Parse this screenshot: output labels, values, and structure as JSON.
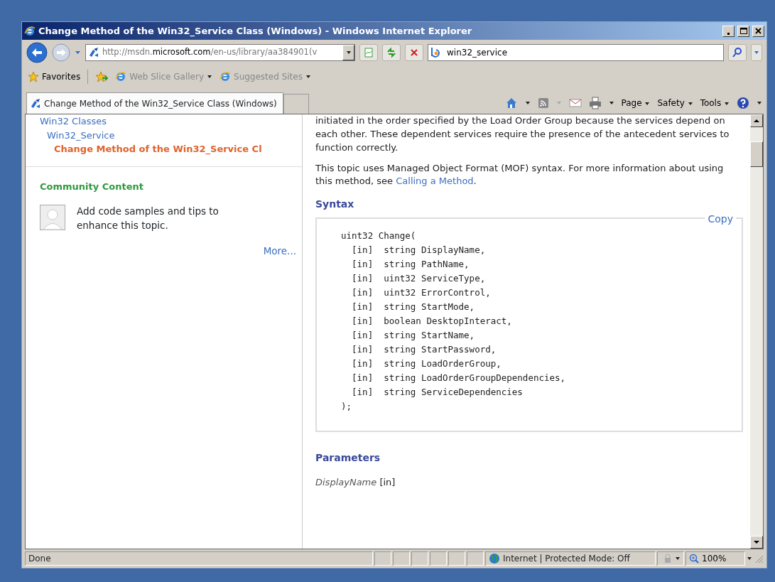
{
  "window": {
    "title": "Change Method of the Win32_Service Class (Windows) - Windows Internet Explorer"
  },
  "address_bar": {
    "url": "http://msdn.**microsoft.com**/en-us/library/aa384901(v"
  },
  "search": {
    "value": "win32_service"
  },
  "favorites_bar": {
    "label": "Favorites",
    "items": [
      {
        "label": "Web Slice Gallery"
      },
      {
        "label": "Suggested Sites"
      }
    ]
  },
  "tabs": [
    {
      "label": "Change Method of the Win32_Service Class (Windows)",
      "selected": true
    }
  ],
  "command_bar": [
    {
      "label": "Page"
    },
    {
      "label": "Safety"
    },
    {
      "label": "Tools"
    }
  ],
  "sidebar": {
    "tree": [
      {
        "label": "Win32 Classes",
        "selected": false,
        "children": [
          {
            "label": "Win32_Service",
            "selected": false,
            "children": [
              {
                "label": "Change Method of the Win32_Service Cl",
                "selected": true
              }
            ]
          }
        ]
      }
    ],
    "community": {
      "heading": "Community Content",
      "text": "Add code samples and tips to enhance this topic.",
      "more": "More..."
    }
  },
  "article": {
    "paragraphs": [
      {
        "text": "initiated in the order specified by the Load Order Group because the services depend on each other. These dependent services require the presence of the antecedent services to function correctly."
      },
      {
        "text": "This topic uses Managed Object Format (MOF) syntax. For more information about using this method, see ",
        "link": "Calling a Method",
        "after": "."
      }
    ],
    "syntax_heading": "Syntax",
    "copy": "Copy",
    "code_lines": [
      "uint32 Change(",
      "  [in]  string DisplayName,",
      "  [in]  string PathName,",
      "  [in]  uint32 ServiceType,",
      "  [in]  uint32 ErrorControl,",
      "  [in]  string StartMode,",
      "  [in]  boolean DesktopInteract,",
      "  [in]  string StartName,",
      "  [in]  string StartPassword,",
      "  [in]  string LoadOrderGroup,",
      "  [in]  string LoadOrderGroupDependencies,",
      "  [in]  string ServiceDependencies",
      ");"
    ],
    "parameters_heading": "Parameters",
    "parameter": {
      "name": "DisplayName",
      "direction": "[in]"
    }
  },
  "status_bar": {
    "status": "Done",
    "zone": "Internet | Protected Mode: Off",
    "zoom": "100%"
  }
}
